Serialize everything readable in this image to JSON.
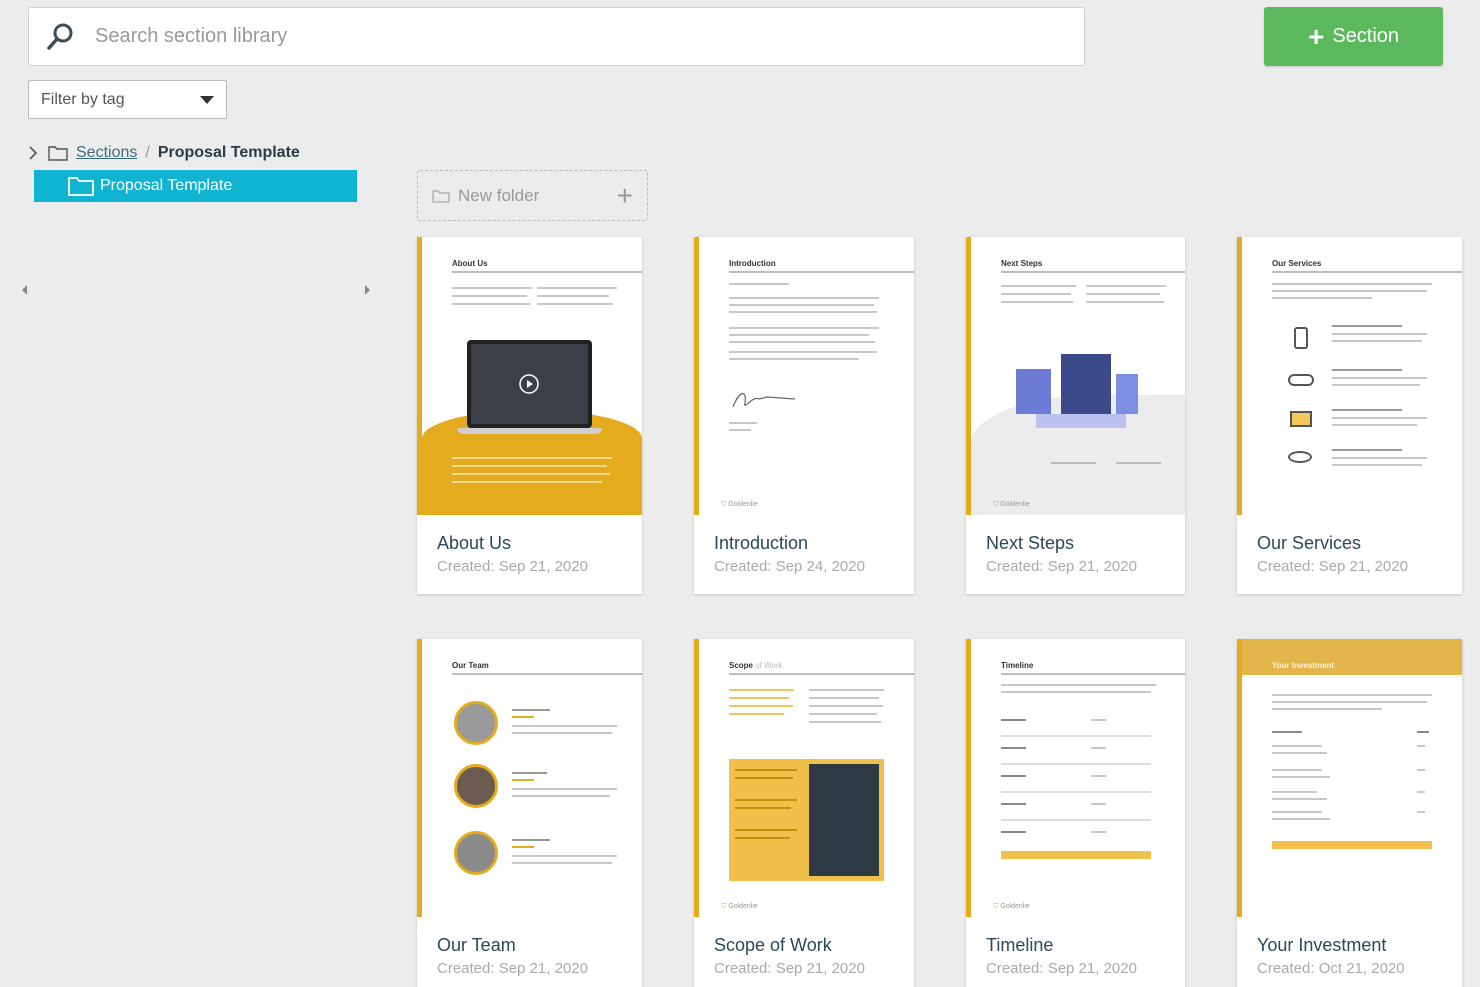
{
  "search": {
    "placeholder": "Search section library"
  },
  "add_button": {
    "label": "Section"
  },
  "filter": {
    "label": "Filter by tag"
  },
  "breadcrumb": {
    "root": "Sections",
    "separator": "/",
    "current": "Proposal Template"
  },
  "tree": {
    "selected": "Proposal Template"
  },
  "new_folder": {
    "label": "New folder"
  },
  "thumbs": {
    "about": "About Us",
    "intro": "Introduction",
    "next": "Next Steps",
    "services": "Our Services",
    "team": "Our Team",
    "scope_a": "Scope",
    "scope_b": "of Work",
    "timeline": "Timeline",
    "investment": "Your Investment",
    "brand": "Goldenlie"
  },
  "cards": [
    {
      "name": "About Us",
      "date": "Created: Sep 21, 2020"
    },
    {
      "name": "Introduction",
      "date": "Created: Sep 24, 2020"
    },
    {
      "name": "Next Steps",
      "date": "Created: Sep 21, 2020"
    },
    {
      "name": "Our Services",
      "date": "Created: Sep 21, 2020"
    },
    {
      "name": "Our Team",
      "date": "Created: Sep 21, 2020"
    },
    {
      "name": "Scope of Work",
      "date": "Created: Sep 21, 2020"
    },
    {
      "name": "Timeline",
      "date": "Created: Sep 21, 2020"
    },
    {
      "name": "Your Investment",
      "date": "Created: Oct 21, 2020"
    }
  ],
  "colors": {
    "accent": "#e3ab1d",
    "primary_button": "#5cb85c",
    "selected": "#10b4d1"
  }
}
